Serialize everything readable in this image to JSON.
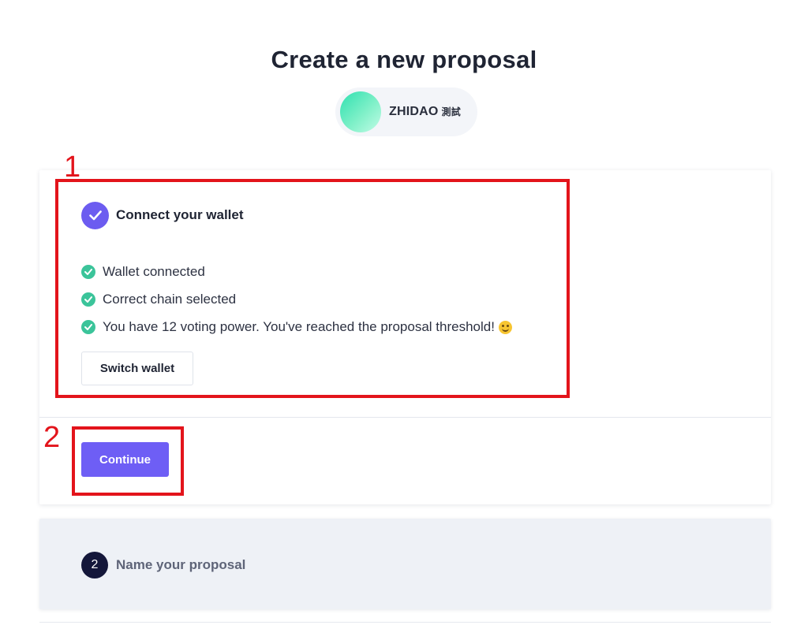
{
  "header": {
    "title": "Create a new proposal"
  },
  "dao": {
    "name": "ZHIDAO",
    "tag": "測試"
  },
  "step1": {
    "title": "Connect your wallet",
    "checks": [
      "Wallet connected",
      "Correct chain selected",
      "You have 12 voting power. You've reached the proposal threshold!"
    ],
    "switch_label": "Switch wallet",
    "continue_label": "Continue"
  },
  "step2": {
    "number": "2",
    "title": "Name your proposal"
  },
  "annotations": {
    "box1_label": "1",
    "box2_label": "2"
  },
  "colors": {
    "accent": "#6e5ef5",
    "success": "#3bc49a",
    "annotation": "#e3141b",
    "step_number_bg": "#14173a"
  }
}
